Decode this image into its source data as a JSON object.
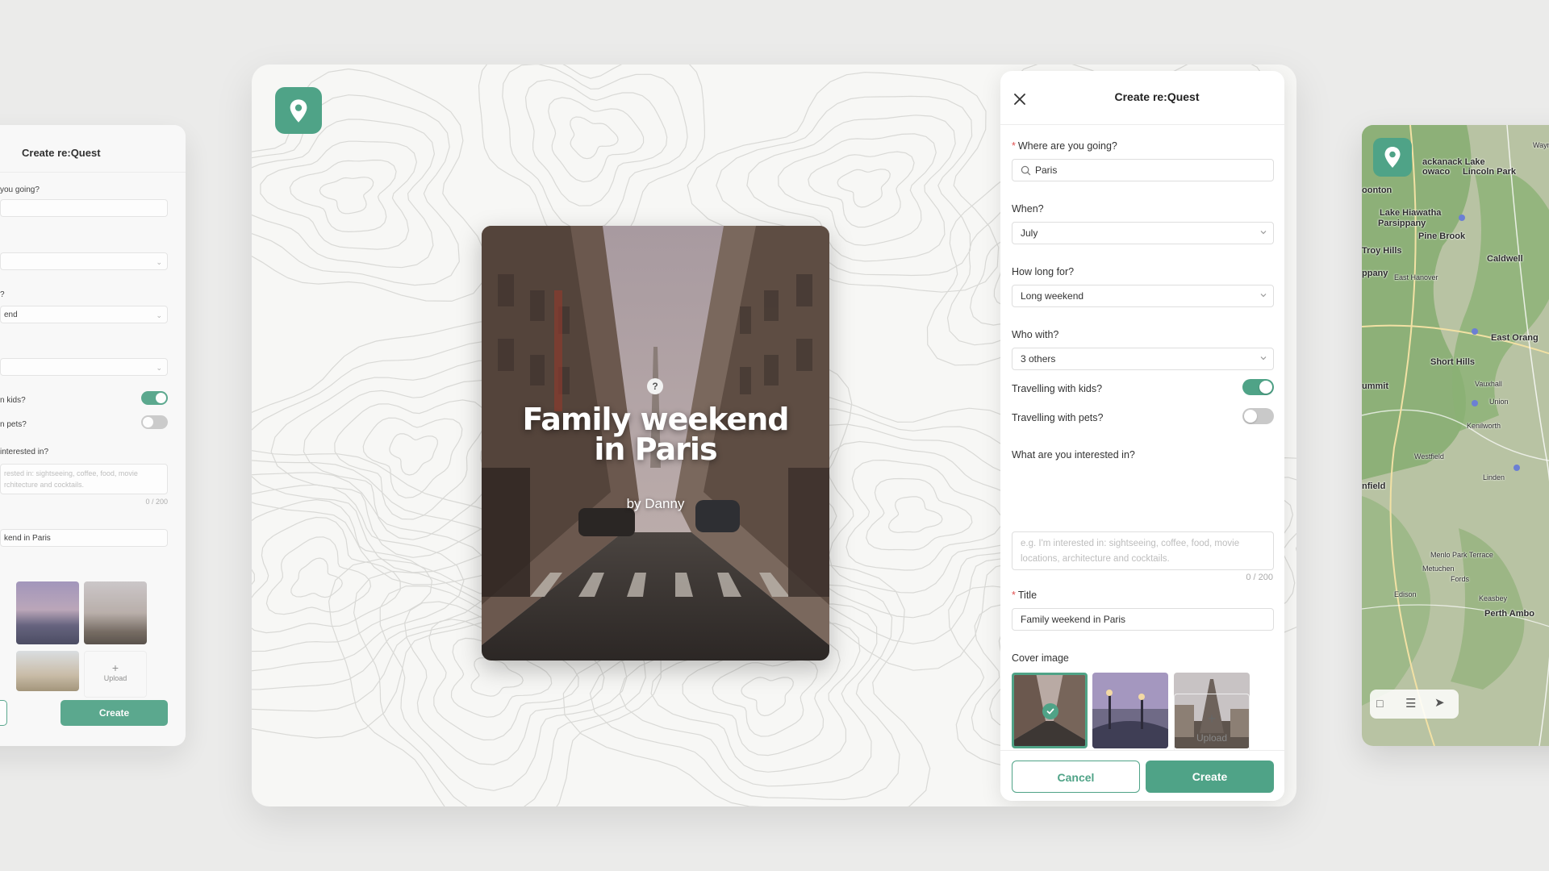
{
  "colors": {
    "accent": "#4fa387",
    "toggle_off": "#c9c9c9",
    "background": "#ebebea"
  },
  "ghost_left": {
    "title": "Create re:Quest",
    "where_label": "you going?",
    "how_long_value": "end",
    "kids_label": "n kids?",
    "pets_label": "n pets?",
    "who_label": "?",
    "interest_label": " interested in?",
    "interest_placeholder_1": "rested in: sightseeing, coffee, food, movie",
    "interest_placeholder_2": "rchitecture and cocktails.",
    "char_count": "0 / 200",
    "title_value": "kend in Paris",
    "upload_label": "Upload",
    "cancel_label": "ncel",
    "create_label": "Create"
  },
  "logo": {
    "icon": "map-pin-icon"
  },
  "preview": {
    "title": "Family weekend in Paris",
    "byline": "by Danny",
    "help_glyph": "?"
  },
  "form": {
    "header_title": "Create re:Quest",
    "close_icon": "close-icon",
    "where": {
      "label": "Where are you going?",
      "value": "Paris",
      "required": "*"
    },
    "when": {
      "label": "When?",
      "value": "July"
    },
    "how_long": {
      "label": "How long for?",
      "value": "Long weekend"
    },
    "who_with": {
      "label": "Who with?",
      "value": "3 others"
    },
    "kids": {
      "label": "Travelling with kids?",
      "on": true
    },
    "pets": {
      "label": "Travelling with pets?",
      "on": false
    },
    "interest": {
      "label": "What are you interested in?",
      "placeholder": "e.g. I'm interested in: sightseeing, coffee, food, movie locations, architecture and cocktails.",
      "count": "0 / 200"
    },
    "title": {
      "label": "Title",
      "value": "Family weekend in Paris",
      "required": "*"
    },
    "cover": {
      "label": "Cover image",
      "selected_index": 0,
      "images": [
        "paris-street",
        "bridge-lamps",
        "eiffel-tower",
        "arc-de-triomphe",
        "paris-skyline"
      ],
      "upload_label": "Upload",
      "upload_glyph": "+"
    },
    "cancel_label": "Cancel",
    "create_label": "Create"
  },
  "map": {
    "labels": [
      "Wayne",
      "Prea",
      "ackanack Lake",
      "owaco",
      "Lincoln Park",
      "oonton",
      "Lake Hiawatha",
      "Parsippany",
      "Pine Brook",
      "Troy Hills",
      "Caldwell",
      "ppany",
      "East Hanover",
      "East Orang",
      "Short Hills",
      "ummit",
      "Vauxhall",
      "Union",
      "Kenilworth",
      "Eliz",
      "Westfield",
      "Linden",
      "nfield",
      "Menlo Park Terrace",
      "Metuchen",
      "Fords",
      "Edison",
      "Keasbey",
      "Perth Ambo",
      "Ca"
    ]
  }
}
